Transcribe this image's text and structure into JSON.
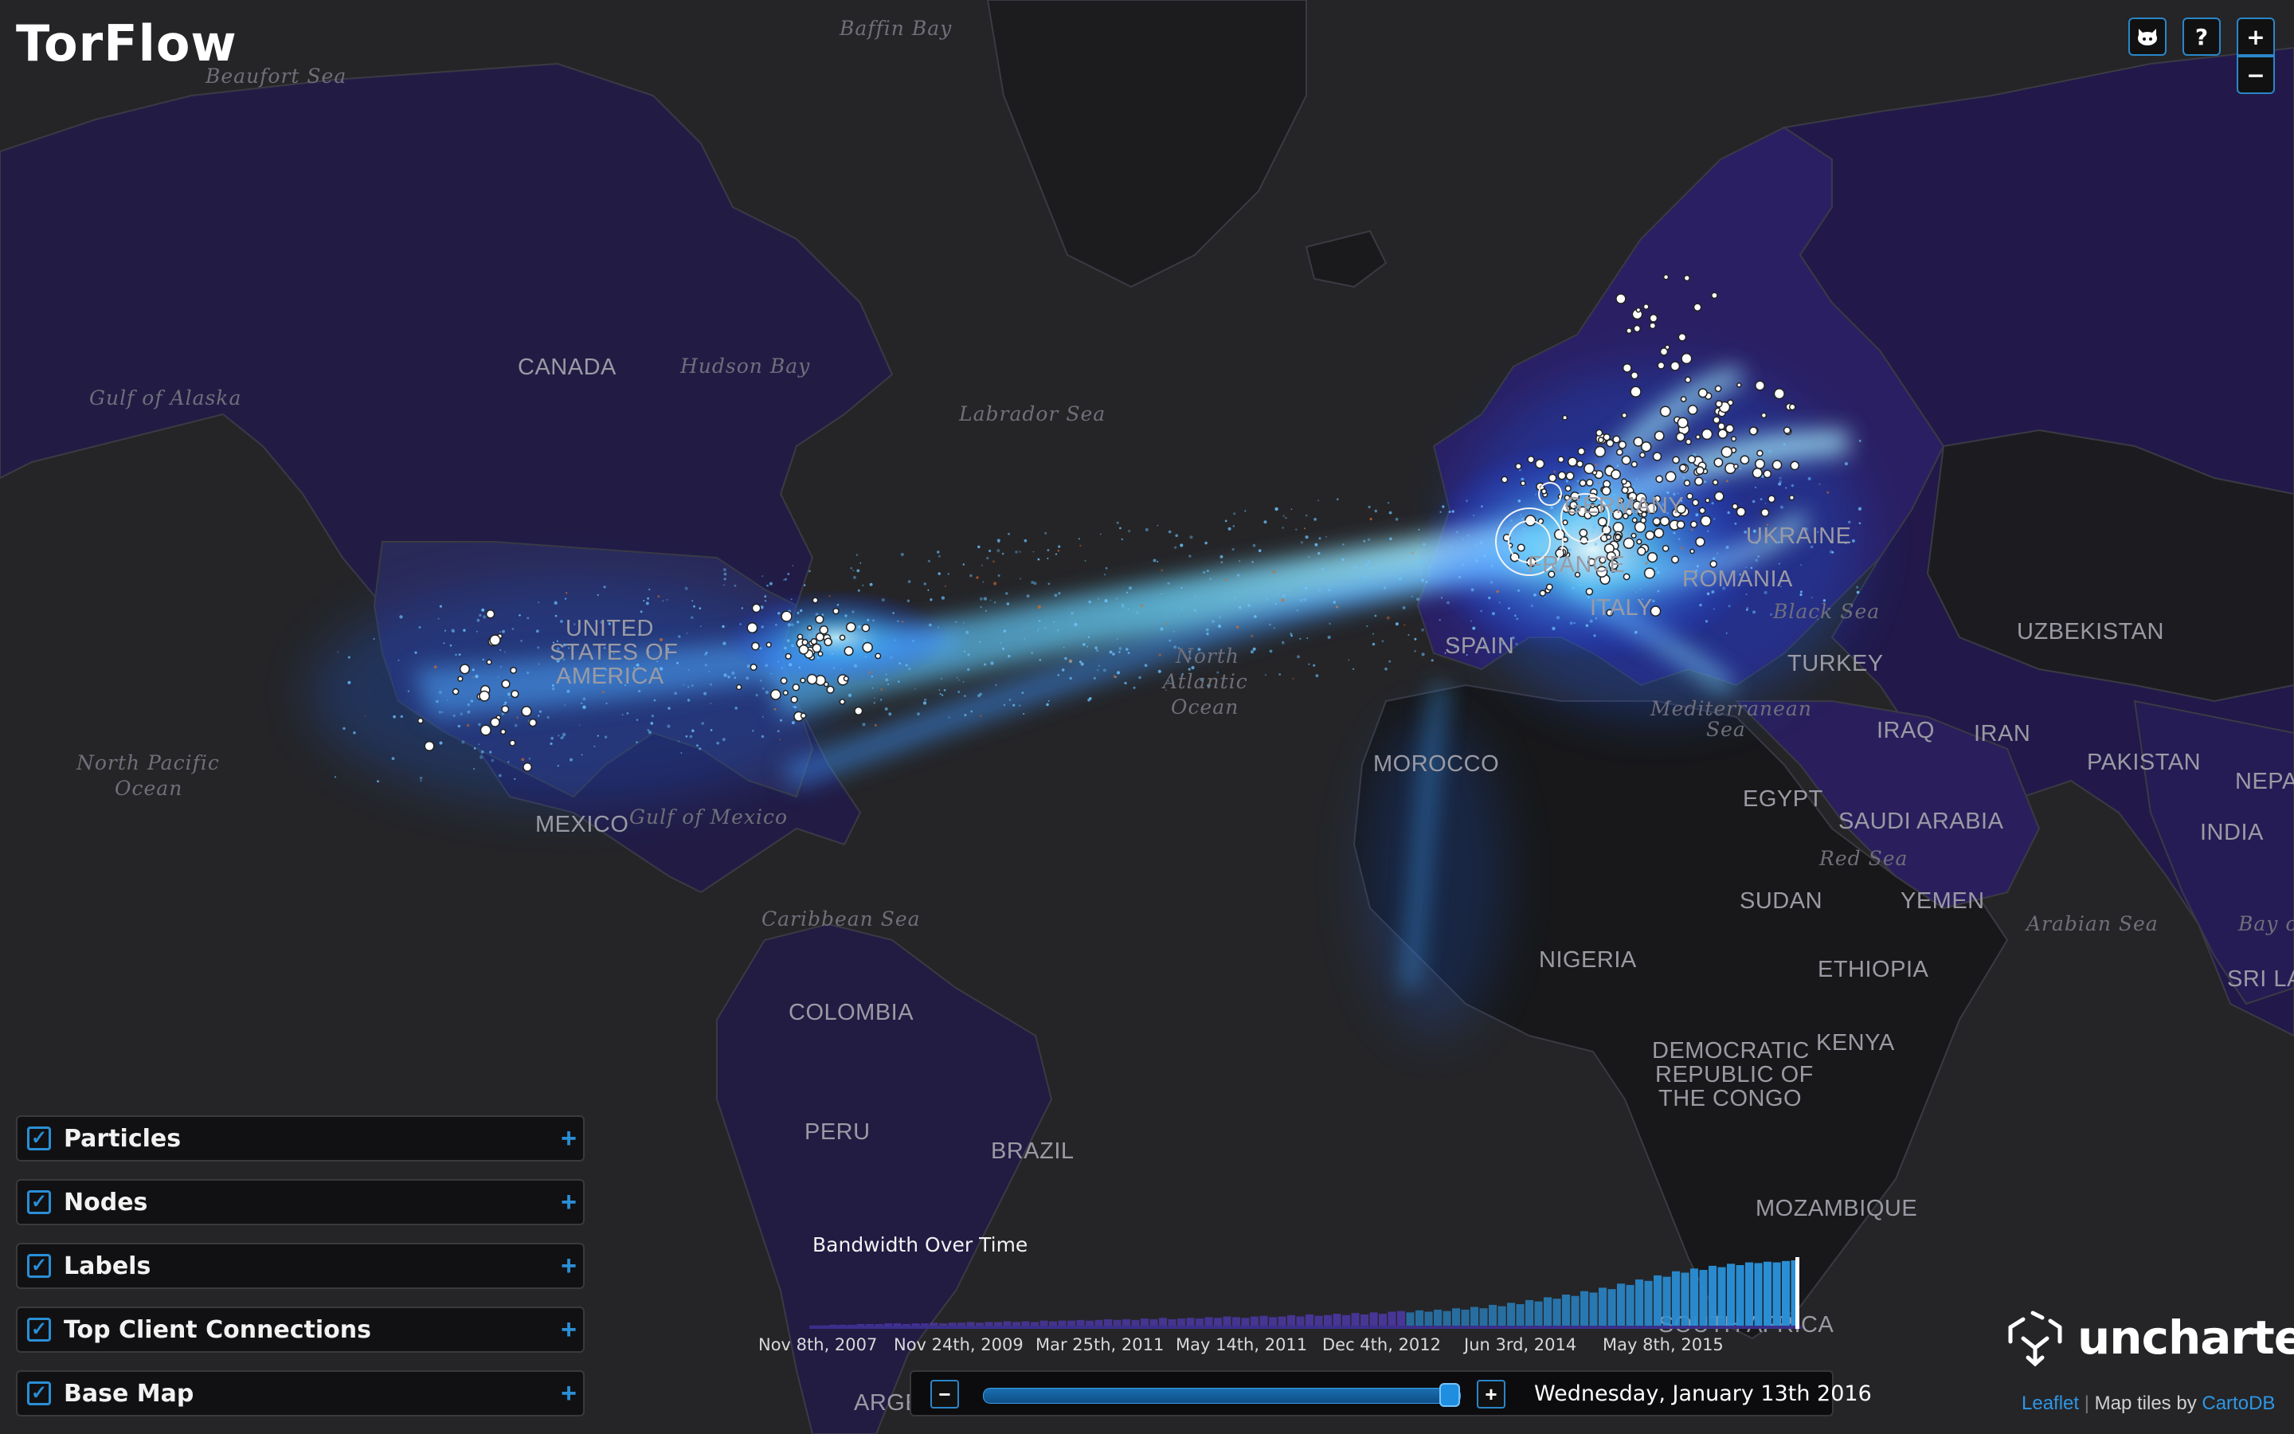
{
  "app": {
    "title": "TorFlow"
  },
  "map_labels": {
    "oceans": {
      "beaufort_sea": "Beaufort Sea",
      "baffin_bay": "Baffin Bay",
      "hudson_bay": "Hudson Bay",
      "gulf_of_alaska": "Gulf of Alaska",
      "labrador_sea": "Labrador Sea",
      "north_pacific_ocean": [
        "North Pacific",
        "Ocean"
      ],
      "north_atlantic_ocean": [
        "North",
        "Atlantic",
        "Ocean"
      ],
      "gulf_of_mexico": "Gulf of Mexico",
      "caribbean_sea": "Caribbean Sea",
      "mediterranean_sea": [
        "Mediterranean",
        "Sea"
      ],
      "black_sea": "Black Sea",
      "red_sea": "Red Sea",
      "arabian_sea": "Arabian Sea",
      "bay_of": "Bay of"
    },
    "countries": {
      "canada": "CANADA",
      "usa": [
        "UNITED",
        "STATES OF",
        "AMERICA"
      ],
      "mexico": "MEXICO",
      "colombia": "COLOMBIA",
      "peru": "PERU",
      "brazil": "BRAZIL",
      "argentina": "ARGENTINA",
      "germany": "GERMANY",
      "france": "FRANCE",
      "spain": "SPAIN",
      "italy": "ITALY",
      "ukraine": "UKRAINE",
      "romania": "ROMANIA",
      "turkey": "TURKEY",
      "uzbekistan": "UZBEKISTAN",
      "iraq": "IRAQ",
      "iran": "IRAN",
      "pakistan": "PAKISTAN",
      "nepal": "NEPAL",
      "india": "INDIA",
      "sri_lanka": "SRI LANKA",
      "morocco": "MOROCCO",
      "egypt": "EGYPT",
      "saudi_arabia": "SAUDI ARABIA",
      "yemen": "YEMEN",
      "sudan": "SUDAN",
      "ethiopia": "ETHIOPIA",
      "nigeria": "NIGERIA",
      "kenya": "KENYA",
      "drc": [
        "DEMOCRATIC",
        "REPUBLIC OF",
        "THE CONGO"
      ],
      "mozambique": "MOZAMBIQUE",
      "south_africa": "SOUTH AFRICA"
    }
  },
  "controls": {
    "github_icon": "github-icon",
    "help_label": "?",
    "zoom_in_label": "+",
    "zoom_out_label": "−"
  },
  "layers": [
    {
      "label": "Particles",
      "checked": true
    },
    {
      "label": "Nodes",
      "checked": true
    },
    {
      "label": "Labels",
      "checked": true
    },
    {
      "label": "Top Client Connections",
      "checked": true
    },
    {
      "label": "Base Map",
      "checked": true
    }
  ],
  "histogram": {
    "title": "Bandwidth Over Time",
    "ticks": [
      "Nov 8th, 2007",
      "Nov 24th, 2009",
      "Mar 25th, 2011",
      "May 14th, 2011",
      "Dec 4th, 2012",
      "Jun 3rd, 2014",
      "May 8th, 2015"
    ],
    "values": [
      0.05,
      0.05,
      0.06,
      0.06,
      0.06,
      0.07,
      0.07,
      0.07,
      0.08,
      0.08,
      0.07,
      0.08,
      0.08,
      0.09,
      0.08,
      0.09,
      0.09,
      0.1,
      0.09,
      0.1,
      0.1,
      0.11,
      0.1,
      0.11,
      0.1,
      0.12,
      0.11,
      0.12,
      0.12,
      0.13,
      0.12,
      0.13,
      0.14,
      0.13,
      0.14,
      0.13,
      0.15,
      0.14,
      0.16,
      0.14,
      0.15,
      0.16,
      0.15,
      0.17,
      0.16,
      0.18,
      0.17,
      0.16,
      0.18,
      0.19,
      0.17,
      0.18,
      0.2,
      0.18,
      0.21,
      0.19,
      0.2,
      0.22,
      0.2,
      0.23,
      0.21,
      0.24,
      0.22,
      0.25,
      0.26,
      0.24,
      0.27,
      0.25,
      0.28,
      0.26,
      0.3,
      0.28,
      0.32,
      0.3,
      0.35,
      0.33,
      0.38,
      0.36,
      0.42,
      0.4,
      0.46,
      0.44,
      0.5,
      0.48,
      0.55,
      0.53,
      0.6,
      0.58,
      0.66,
      0.64,
      0.72,
      0.7,
      0.78,
      0.76,
      0.84,
      0.82,
      0.88,
      0.86,
      0.92,
      0.9,
      0.95,
      0.93,
      0.97,
      0.96,
      0.98,
      0.97,
      0.99,
      1.0
    ],
    "accent_color": "#2a8fd6"
  },
  "slider": {
    "minus_label": "−",
    "plus_label": "+",
    "position": 0.98,
    "date": "Wednesday, January 13th 2016"
  },
  "branding": {
    "logo_icon": "uncharted-logo-icon",
    "logo_text": "uncharted"
  },
  "attribution": {
    "leaflet": "Leaflet",
    "separator": "|",
    "tiles_prefix": "Map tiles by",
    "cartodb": "CartoDB"
  }
}
